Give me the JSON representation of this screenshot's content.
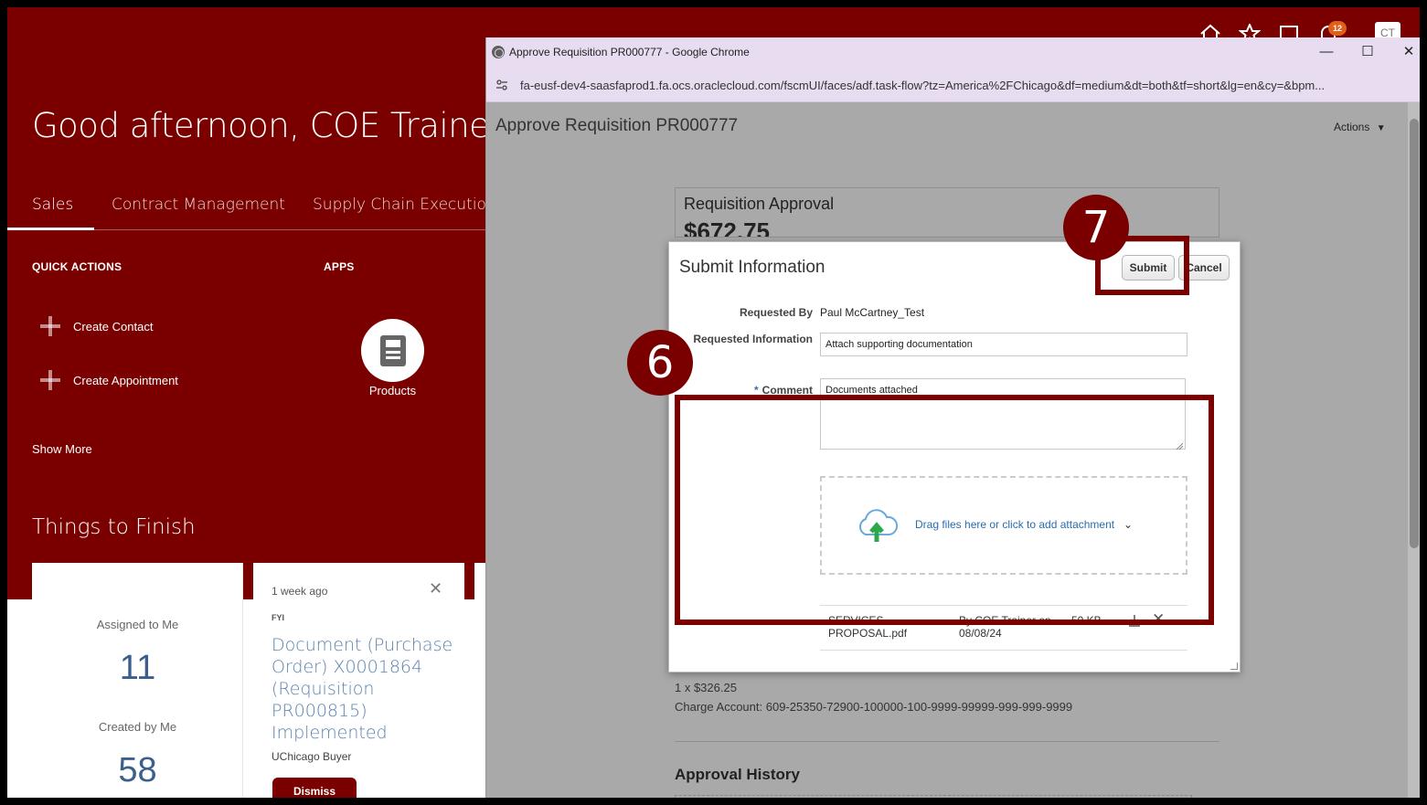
{
  "home": {
    "greeting": "Good afternoon, COE Trainer",
    "tabs": [
      "Sales",
      "Contract Management",
      "Supply Chain Execution"
    ],
    "quick_actions_label": "QUICK ACTIONS",
    "apps_label": "APPS",
    "quick_actions": [
      "Create Contact",
      "Create Appointment"
    ],
    "show_more": "Show More",
    "app_tile": "Products",
    "things_to_finish": "Things to Finish",
    "notification_count": "12",
    "avatar_initials": "CT",
    "summary_card": {
      "assigned_label": "Assigned to Me",
      "assigned_count": "11",
      "created_label": "Created by Me",
      "created_count": "58"
    },
    "fyi_card": {
      "time": "1 week ago",
      "category": "FYI",
      "title": "Document (Purchase Order) X0001864 (Requisition PR000815) Implemented",
      "author": "UChicago Buyer",
      "dismiss_label": "Dismiss"
    }
  },
  "popup": {
    "window_title": "Approve Requisition PR000777 - Google Chrome",
    "url": "fa-eusf-dev4-saasfaprod1.fa.ocs.oraclecloud.com/fscmUI/faces/adf.task-flow?tz=America%2FChicago&df=medium&dt=both&tf=short&lg=en&cy=&bpm...",
    "page_title": "Approve Requisition PR000777",
    "actions_label": "Actions",
    "req_approval_title": "Requisition Approval",
    "req_amount": "$672.75",
    "line_qty": "1 x $326.25",
    "charge_account": "Charge Account: 609-25350-72900-100000-100-9999-99999-999-999-9999",
    "approval_history": "Approval History"
  },
  "dialog": {
    "title": "Submit Information",
    "submit_label": "Submit",
    "cancel_label": "Cancel",
    "requested_by_label": "Requested By",
    "requested_by_value": "Paul McCartney_Test",
    "requested_info_label": "Requested Information",
    "requested_info_value": "Attach supporting documentation",
    "comment_label": "Comment",
    "comment_required": "*",
    "comment_value": "Documents attached",
    "dropzone_text": "Drag files here or click to add attachment",
    "attachment": {
      "name": "SERVICES PROPOSAL.pdf",
      "by": "By COE Trainer on 08/08/24",
      "size": "50 KB"
    }
  },
  "annotations": {
    "step6": "6",
    "step7": "7",
    "color": "#7a0000"
  }
}
